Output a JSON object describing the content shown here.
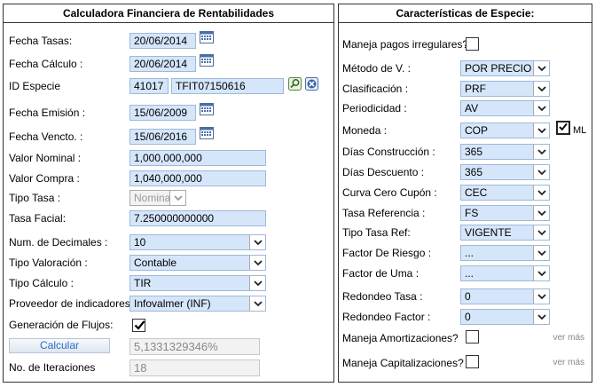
{
  "left_panel": {
    "title": "Calculadora Financiera de Rentabilidades",
    "fecha_tasas": {
      "label": "Fecha Tasas:",
      "value": "20/06/2014"
    },
    "fecha_calculo": {
      "label": "Fecha Cálculo :",
      "value": "20/06/2014"
    },
    "id_especie": {
      "label": "ID Especie",
      "code": "41017",
      "value": "TFIT07150616"
    },
    "fecha_emision": {
      "label": "Fecha Emisión :",
      "value": "15/06/2009"
    },
    "fecha_vencto": {
      "label": "Fecha Vencto. :",
      "value": "15/06/2016"
    },
    "valor_nominal": {
      "label": "Valor Nominal :",
      "value": "1,000,000,000"
    },
    "valor_compra": {
      "label": "Valor Compra :",
      "value": "1,040,000,000"
    },
    "tipo_tasa": {
      "label": "Tipo Tasa :",
      "value": "Nominal"
    },
    "tasa_facial": {
      "label": "Tasa Facial:",
      "value": "7.250000000000"
    },
    "num_decimales": {
      "label": "Num. de Decimales :",
      "value": "10"
    },
    "tipo_valoracion": {
      "label": "Tipo Valoración :",
      "value": "Contable"
    },
    "tipo_calculo": {
      "label": "Tipo Cálculo :",
      "value": "TIR"
    },
    "proveedor": {
      "label": "Proveedor de indicadores :",
      "value": "Infovalmer (INF)"
    },
    "generacion_flujos": {
      "label": "Generación de Flujos:",
      "checked": true
    },
    "calcular_label": "Calcular",
    "resultado": "5,1331329346%",
    "iteraciones": {
      "label": "No. de Iteraciones",
      "value": "18"
    }
  },
  "right_panel": {
    "title": "Características de Especie:",
    "pagos_irregulares": {
      "label": "Maneja pagos irregulares?",
      "checked": false
    },
    "metodo": {
      "label": "Método de V. :",
      "value": "POR PRECIO Y"
    },
    "clasificacion": {
      "label": "Clasificación :",
      "value": "PRF"
    },
    "periodicidad": {
      "label": "Periodicidad :",
      "value": "AV"
    },
    "moneda": {
      "label": "Moneda :",
      "value": "COP",
      "ml_label": "ML",
      "ml_checked": true
    },
    "dias_construccion": {
      "label": "Días Construcción :",
      "value": "365"
    },
    "dias_descuento": {
      "label": "Días Descuento :",
      "value": "365"
    },
    "curva": {
      "label": "Curva Cero Cupón :",
      "value": "CEC"
    },
    "tasa_referencia": {
      "label": "Tasa Referencia :",
      "value": "FS"
    },
    "tipo_tasa_ref": {
      "label": "Tipo Tasa Ref:",
      "value": "VIGENTE"
    },
    "factor_riesgo": {
      "label": "Factor De Riesgo :",
      "value": "..."
    },
    "factor_uma": {
      "label": "Factor de Uma :",
      "value": "..."
    },
    "redondeo_tasa": {
      "label": "Redondeo Tasa :",
      "value": "0"
    },
    "redondeo_factor": {
      "label": "Redondeo Factor :",
      "value": "0"
    },
    "amortizaciones": {
      "label": "Maneja Amortizaciones?",
      "checked": false,
      "ver_mas": "ver más"
    },
    "capitalizaciones": {
      "label": "Maneja Capitalizaciones?",
      "checked": false,
      "ver_mas": "ver más"
    }
  },
  "colors": {
    "field_bg": "#d5e6fb",
    "field_border": "#9fb8d5",
    "button_text": "#2a6fc6"
  }
}
